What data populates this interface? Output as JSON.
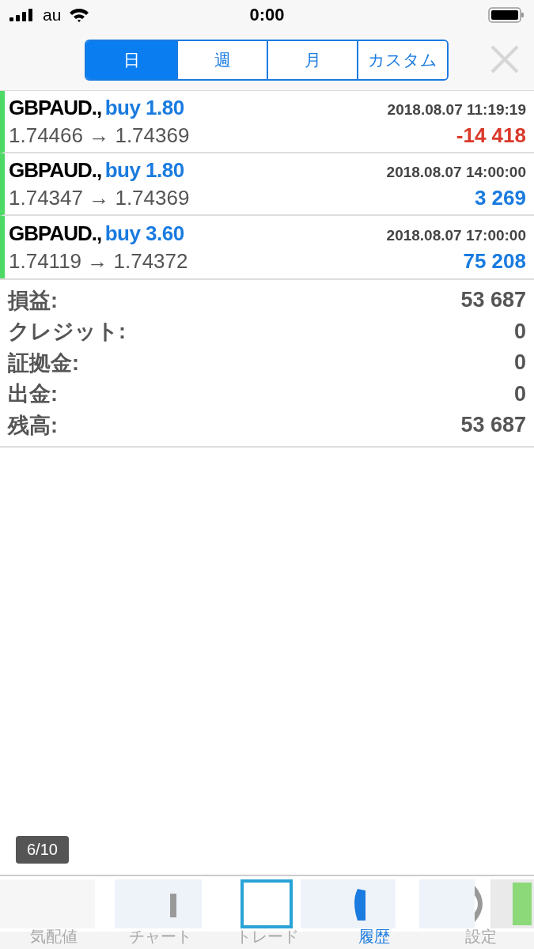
{
  "status_bar": {
    "carrier": "au",
    "time": "0:00"
  },
  "period_tabs": [
    {
      "label": "日",
      "selected": true
    },
    {
      "label": "週",
      "selected": false
    },
    {
      "label": "月",
      "selected": false
    },
    {
      "label": "カスタム",
      "selected": false
    }
  ],
  "trades": [
    {
      "symbol": "GBPAUD.,",
      "order": "buy 1.80",
      "time": "2018.08.07 11:19:19",
      "prices": "1.74466 → 1.74369",
      "profit": "-14 418",
      "kind": "loss"
    },
    {
      "symbol": "GBPAUD.,",
      "order": "buy 1.80",
      "time": "2018.08.07 14:00:00",
      "prices": "1.74347 → 1.74369",
      "profit": "3 269",
      "kind": "gain"
    },
    {
      "symbol": "GBPAUD.,",
      "order": "buy 3.60",
      "time": "2018.08.07 17:00:00",
      "prices": "1.74119 → 1.74372",
      "profit": "75 208",
      "kind": "gain"
    }
  ],
  "summary": [
    {
      "label": "損益:",
      "value": "53 687"
    },
    {
      "label": "クレジット:",
      "value": "0"
    },
    {
      "label": "証拠金:",
      "value": "0"
    },
    {
      "label": "出金:",
      "value": "0"
    },
    {
      "label": "残高:",
      "value": "53 687"
    }
  ],
  "page_badge": "6/10",
  "bottom_tabs": [
    {
      "label": "気配値",
      "selected": false
    },
    {
      "label": "チャート",
      "selected": false
    },
    {
      "label": "トレード",
      "selected": false
    },
    {
      "label": "履歴",
      "selected": true
    },
    {
      "label": "設定",
      "selected": false
    }
  ]
}
